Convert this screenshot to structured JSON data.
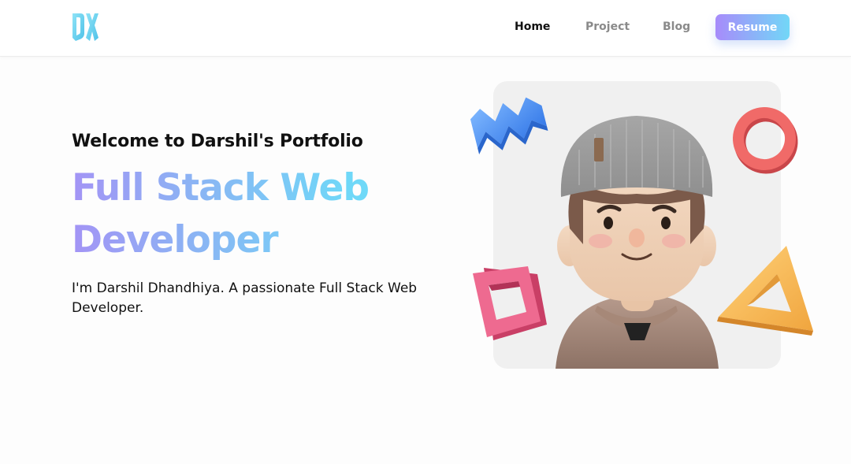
{
  "nav": {
    "logo_icon": "dx-monogram-icon",
    "links": [
      {
        "label": "Home",
        "active": true
      },
      {
        "label": "Project",
        "active": false
      },
      {
        "label": "Blog",
        "active": false
      }
    ],
    "resume_label": "Resume"
  },
  "hero": {
    "welcome": "Welcome to Darshil's Portfolio",
    "headline": "Full Stack Web Developer",
    "tagline": "I'm Darshil Dhandhiya. A passionate Full Stack Web Developer."
  },
  "colors": {
    "accent_start": "#a78bfa",
    "accent_end": "#72d7f7",
    "text": "#111111",
    "nav_inactive": "#8a8a8a"
  },
  "illustration": {
    "icons": [
      "avatar-icon",
      "blue-wave-shape-icon",
      "red-ring-shape-icon",
      "pink-square-frame-icon",
      "orange-triangle-shape-icon"
    ]
  }
}
